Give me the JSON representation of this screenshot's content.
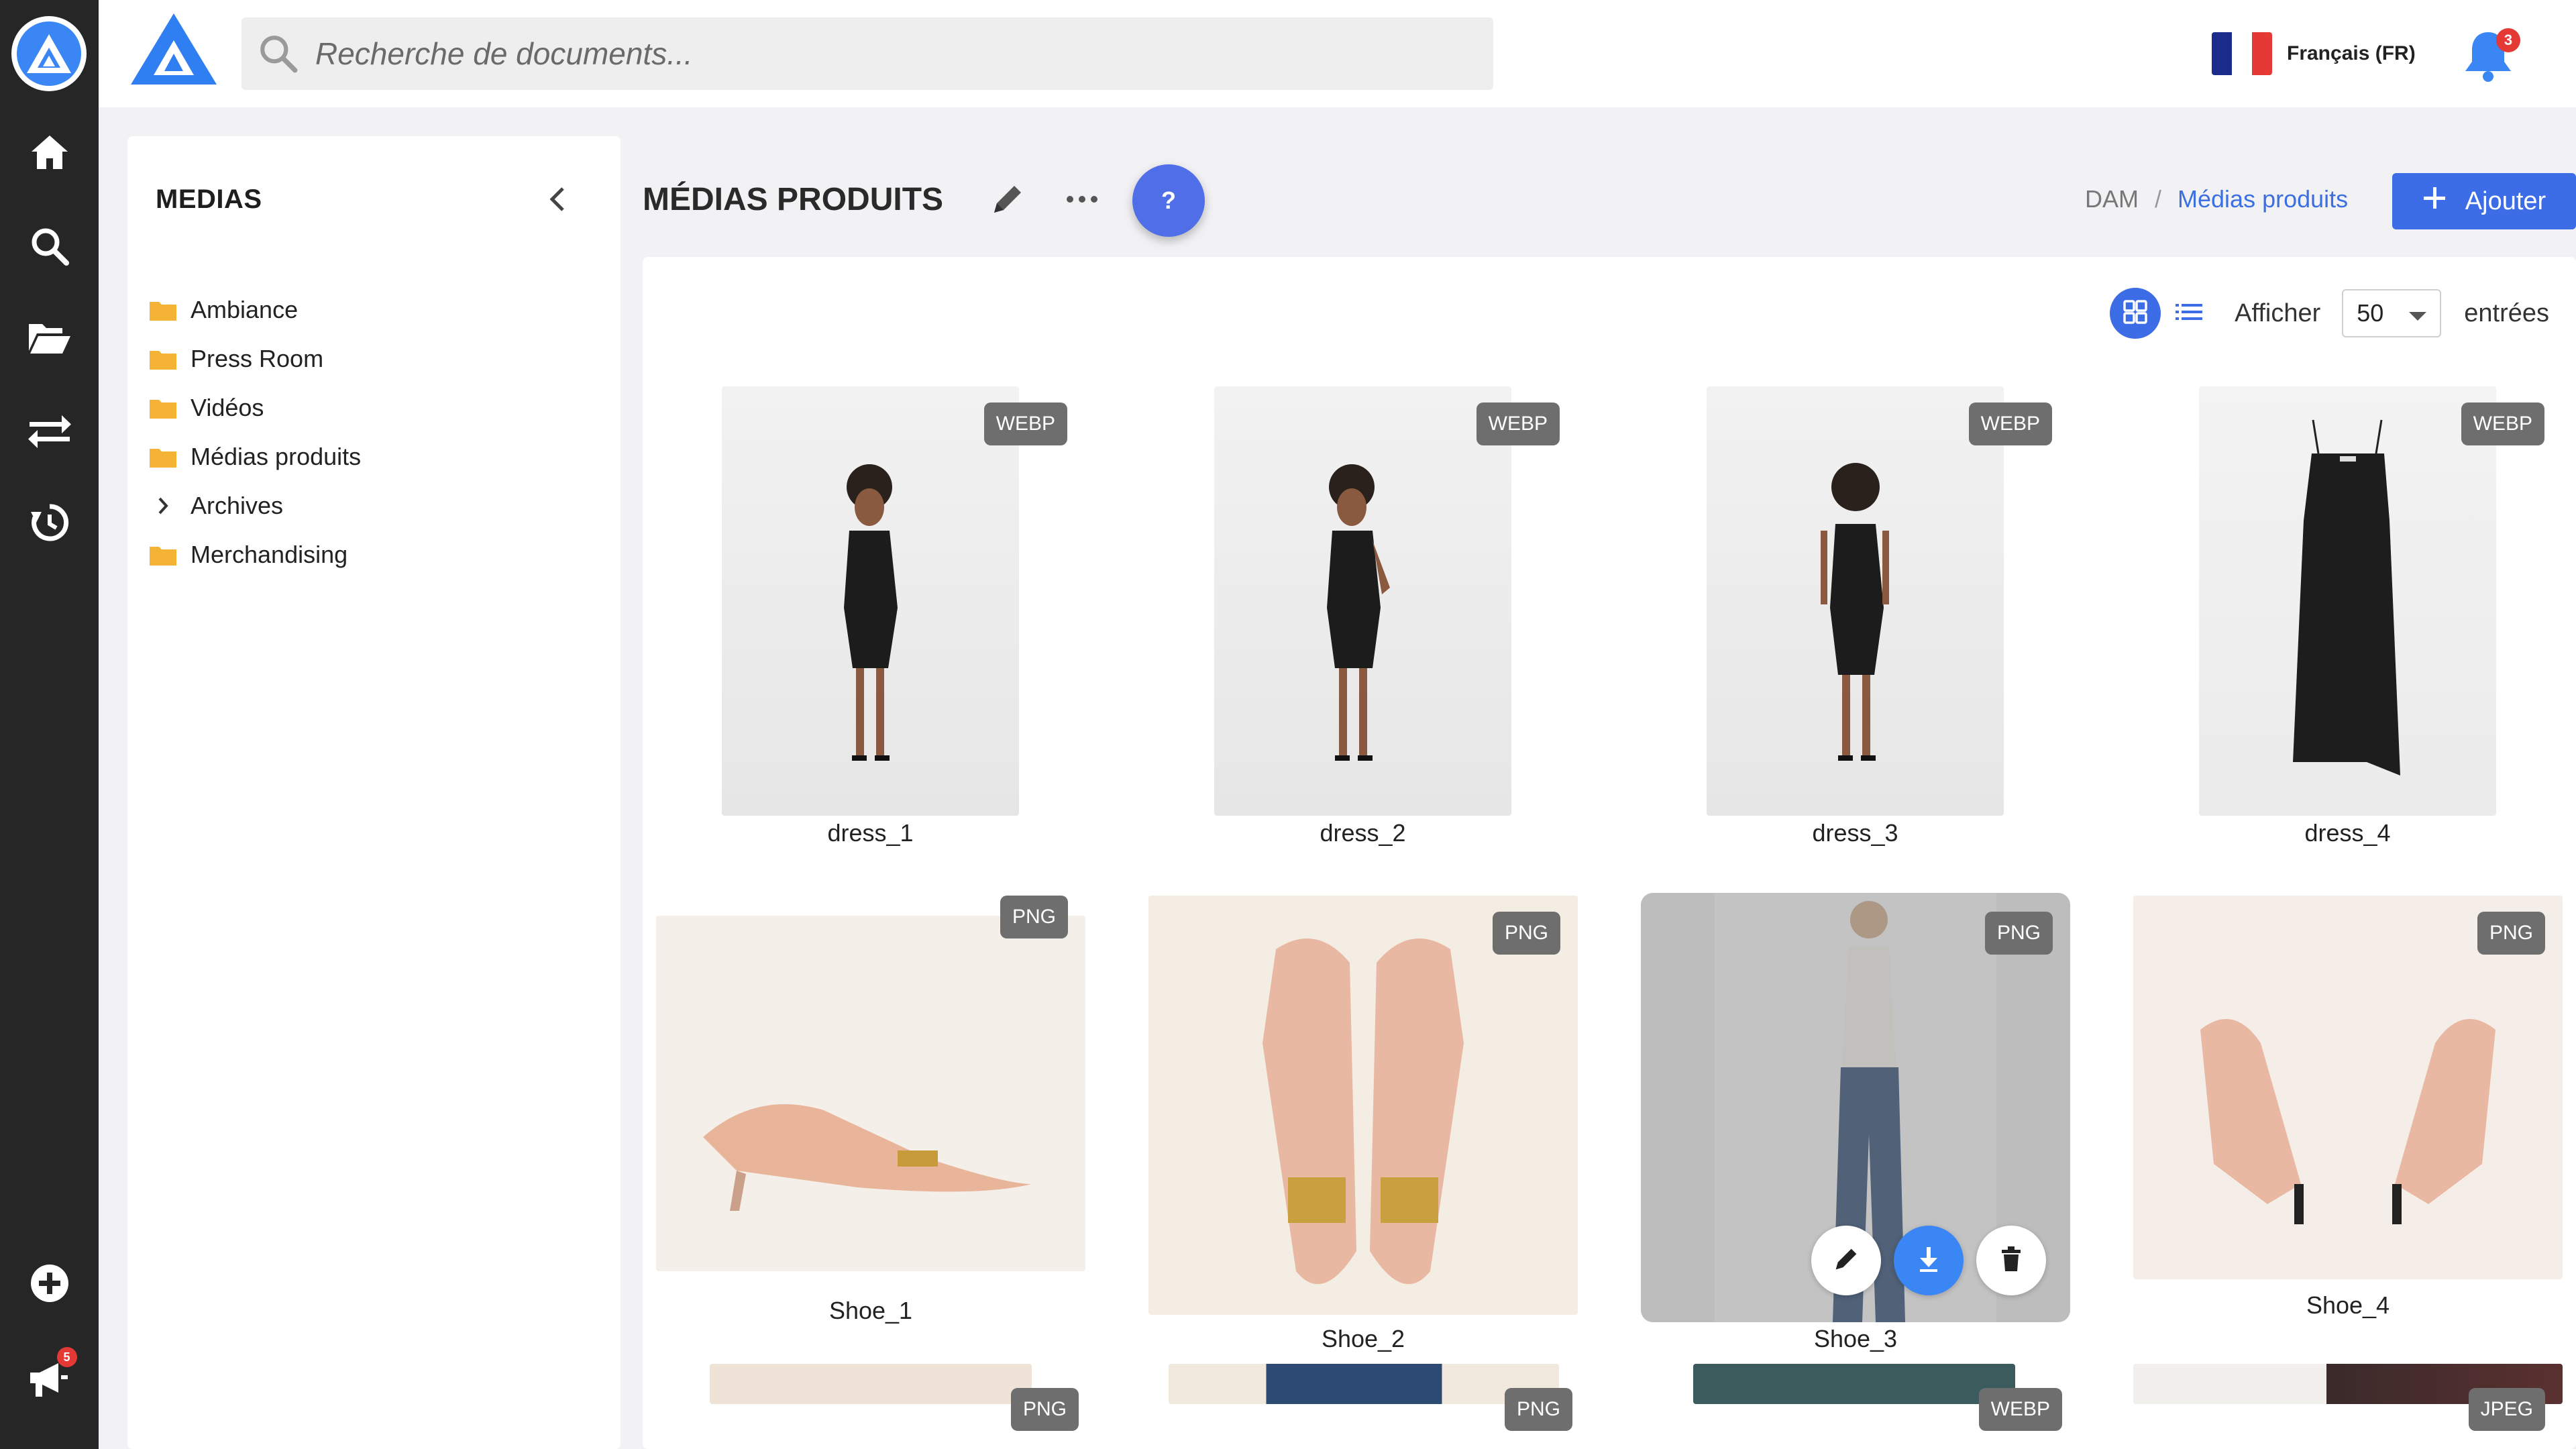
{
  "app": {
    "brand_color": "#3a86f5",
    "accent": "#3d6de6"
  },
  "rail": {
    "items": [
      {
        "icon": "home-icon"
      },
      {
        "icon": "search-icon"
      },
      {
        "icon": "folder-open-icon"
      },
      {
        "icon": "transfer-icon"
      },
      {
        "icon": "history-icon"
      },
      {
        "icon": "add-circle-icon"
      },
      {
        "icon": "megaphone-icon",
        "badge": "5"
      }
    ]
  },
  "topbar": {
    "search_placeholder": "Recherche de documents...",
    "language": "Français (FR)",
    "notifications_count": "3"
  },
  "sidebar": {
    "title": "MEDIAS",
    "items": [
      {
        "label": "Ambiance",
        "icon": "folder-icon"
      },
      {
        "label": "Press Room",
        "icon": "folder-icon"
      },
      {
        "label": "Vidéos",
        "icon": "folder-icon"
      },
      {
        "label": "Médias produits",
        "icon": "folder-icon"
      },
      {
        "label": "Archives",
        "icon": "chevron-right-icon"
      },
      {
        "label": "Merchandising",
        "icon": "folder-icon"
      }
    ]
  },
  "header": {
    "title": "MÉDIAS PRODUITS",
    "help_label": "?",
    "breadcrumb": [
      "DAM",
      "Médias produits"
    ],
    "breadcrumb_sep": "/",
    "add_label": "Ajouter"
  },
  "toolbar": {
    "show_label": "Afficher",
    "page_size": "50",
    "entries_label": "entrées"
  },
  "media": [
    {
      "name": "dress_1",
      "format": "WEBP"
    },
    {
      "name": "dress_2",
      "format": "WEBP"
    },
    {
      "name": "dress_3",
      "format": "WEBP"
    },
    {
      "name": "dress_4",
      "format": "WEBP"
    },
    {
      "name": "Shoe_1",
      "format": "PNG"
    },
    {
      "name": "Shoe_2",
      "format": "PNG"
    },
    {
      "name": "Shoe_3",
      "format": "PNG"
    },
    {
      "name": "Shoe_4",
      "format": "PNG"
    },
    {
      "name": "",
      "format": "PNG"
    },
    {
      "name": "",
      "format": "PNG"
    },
    {
      "name": "",
      "format": "WEBP"
    },
    {
      "name": "",
      "format": "JPEG"
    }
  ]
}
